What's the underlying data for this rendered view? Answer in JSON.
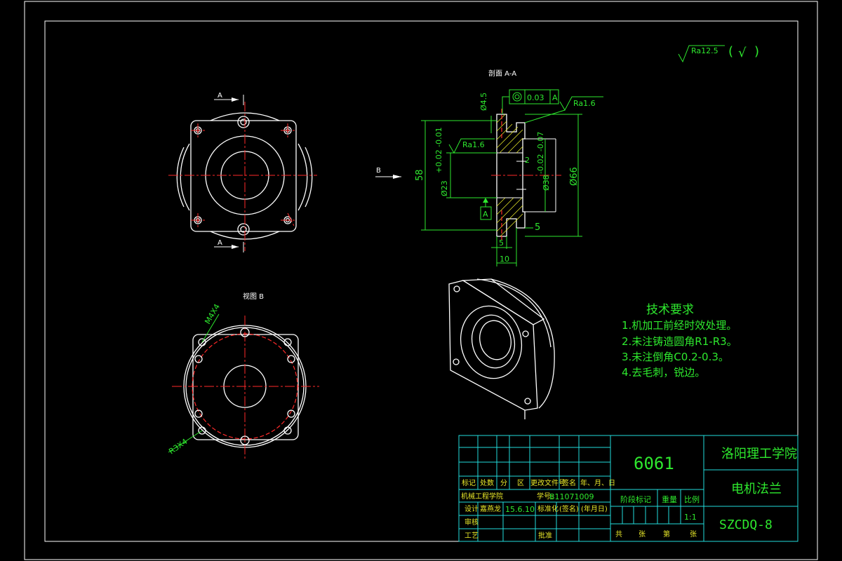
{
  "colors": {
    "background": "#000000",
    "outline": "#ffffff",
    "centerline": "#ff2a2a",
    "dimension": "#2ee82e",
    "table": "#22dddd",
    "hatch": "#e6e629"
  },
  "roughness_general": {
    "label": "Ra12.5",
    "open": "(",
    "check": "√",
    "close": ")"
  },
  "front_view": {
    "section_marker_top": "A",
    "section_marker_bottom": "A"
  },
  "view_b_arrow": {
    "label": "B"
  },
  "section_view": {
    "title": "剖面 A-A",
    "tolerance_frame": {
      "symbol": "◎",
      "value": "0.03",
      "datum": "A"
    },
    "roughness_top": "Ra1.6",
    "roughness_left": "Ra1.6",
    "datum_label": "A",
    "dims": {
      "d_hole": "Ø4.5",
      "height": "58",
      "d_bore": "Ø23",
      "d_bore_tol": "+0.02\n-0.01",
      "d_boss": "Ø38",
      "d_boss_tol": "-0.02\n-0.07",
      "d_outer": "Ø66",
      "step": "2",
      "flange_t": "5",
      "groove": "5",
      "total_t": "10"
    }
  },
  "view_b": {
    "title": "视图 B",
    "label_holes_m": "M4X4",
    "label_holes_r": "R3X4"
  },
  "tech_notes": {
    "title": "技术要求",
    "items": [
      "1.机加工前经时效处理。",
      "2.未注铸造圆角R1-R3。",
      "3.未注倒角C0.2-0.3。",
      "4.去毛刺，锐边。"
    ]
  },
  "title_block": {
    "material": "6061",
    "school": "洛阳理工学院",
    "part_name": "电机法兰",
    "drawing_no": "SZCDQ-8",
    "scale_label": "比例",
    "scale_value": "1:1",
    "stage_label": "阶段标记",
    "weight_label": "重量",
    "sheet_total": "共",
    "sheet_total_unit": "张",
    "sheet_no": "第",
    "sheet_no_unit": "张",
    "row_headers": [
      "标记",
      "处数",
      "分",
      "区",
      "更改文件号",
      "签名",
      "年、月、日"
    ],
    "class_label": "机械工程学院",
    "student_no_label": "学号:",
    "student_no": "B11071009",
    "design_label": "设计",
    "design_name": "嘉燕龙",
    "design_date": "15.6.10",
    "standard_label": "标准化",
    "sign_label": "(签名)",
    "date_label": "(年月日)",
    "review_label": "审核",
    "process_label": "工艺",
    "approve_label": "批准"
  }
}
